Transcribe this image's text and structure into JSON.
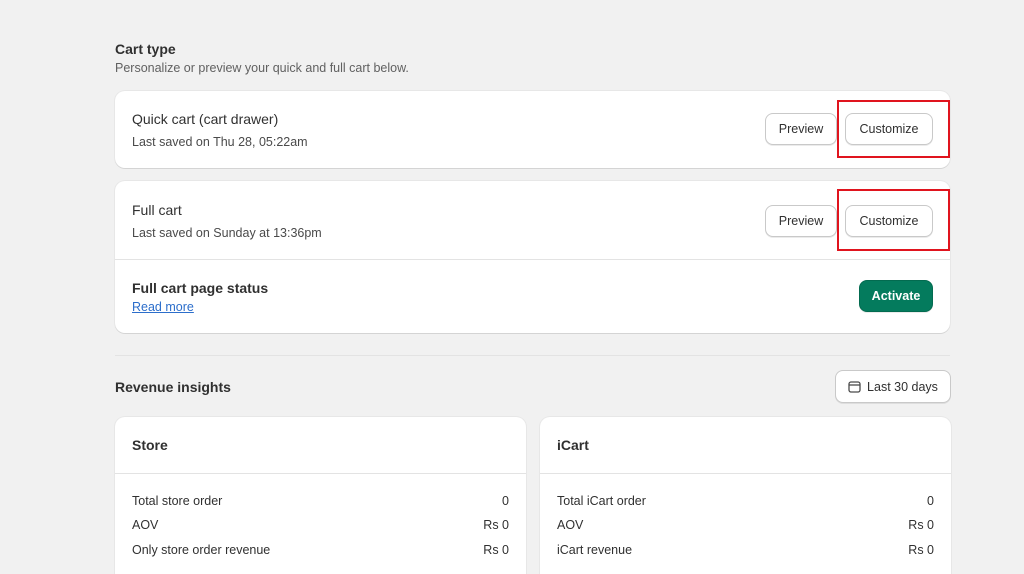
{
  "cart_type": {
    "title": "Cart type",
    "subtitle": "Personalize or preview your quick and full cart below."
  },
  "quick_cart": {
    "title": "Quick cart (cart drawer)",
    "saved": "Last saved on Thu 28, 05:22am",
    "preview_label": "Preview",
    "customize_label": "Customize"
  },
  "full_cart": {
    "title": "Full cart",
    "saved": "Last saved on Sunday at 13:36pm",
    "preview_label": "Preview",
    "customize_label": "Customize",
    "status_title": "Full cart page status",
    "read_more": "Read more",
    "activate_label": "Activate"
  },
  "revenue": {
    "title": "Revenue insights",
    "date_range": "Last 30 days",
    "date_icon": "calendar-icon"
  },
  "store": {
    "title": "Store",
    "rows": [
      {
        "label": "Total store order",
        "value": "0"
      },
      {
        "label": "AOV",
        "value": "Rs 0"
      },
      {
        "label": "Only store order revenue",
        "value": "Rs 0"
      }
    ]
  },
  "icart": {
    "title": "iCart",
    "rows": [
      {
        "label": "Total iCart order",
        "value": "0"
      },
      {
        "label": "AOV",
        "value": "Rs 0"
      },
      {
        "label": "iCart revenue",
        "value": "Rs 0"
      }
    ]
  },
  "colors": {
    "background": "#f1f1f1",
    "card": "#ffffff",
    "activate": "#047b5d",
    "highlight": "#e0141e",
    "link": "#2c6ecb"
  }
}
